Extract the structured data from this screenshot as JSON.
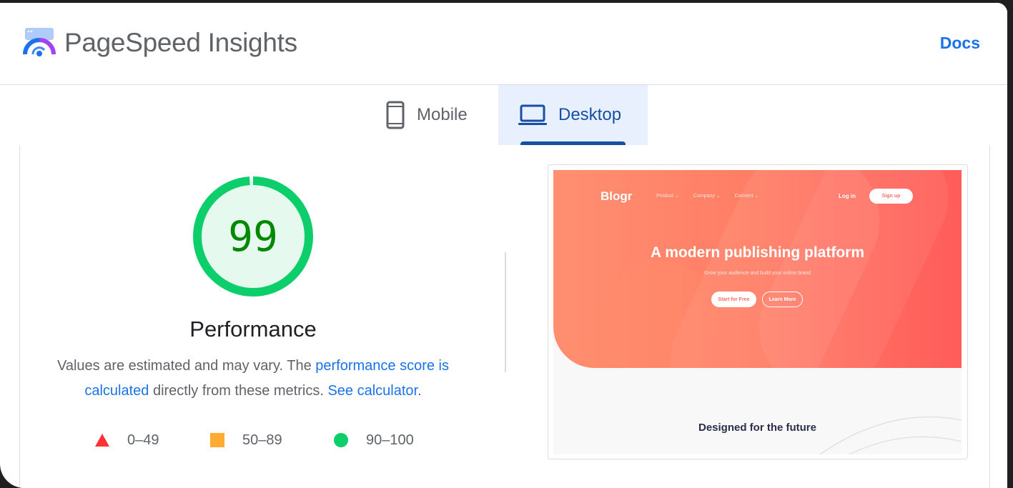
{
  "header": {
    "title": "PageSpeed Insights",
    "logo_icon": "pagespeed-logo-icon",
    "docs_label": "Docs"
  },
  "tabs": [
    {
      "label": "Mobile",
      "icon": "phone-icon",
      "selected": false
    },
    {
      "label": "Desktop",
      "icon": "laptop-icon",
      "selected": true
    }
  ],
  "performance": {
    "score": "99",
    "score_value": 99,
    "title": "Performance",
    "desc_part1": "Values are estimated and may vary. The ",
    "desc_link1": "performance score is calculated",
    "desc_part2": " directly from these metrics. ",
    "desc_link2": "See calculator",
    "desc_part3": ".",
    "legend": [
      {
        "shape": "triangle",
        "range": "0–49",
        "color": "#ff3333"
      },
      {
        "shape": "square",
        "range": "50–89",
        "color": "#ffaa33"
      },
      {
        "shape": "circle",
        "range": "90–100",
        "color": "#0cce6b"
      }
    ]
  },
  "colors": {
    "pass_ring": "#0cce6b",
    "pass_fill": "#e6f9ee",
    "pass_text": "#008800",
    "accent": "#1a73e8",
    "tab_active": "#174ea6"
  },
  "screenshot": {
    "logo": "Blogr",
    "nav": [
      "Product ⌄",
      "Company ⌄",
      "Connect ⌄"
    ],
    "login": "Log in",
    "signup": "Sign up",
    "headline": "A modern publishing platform",
    "subheadline": "Grow your audience and build your online brand",
    "cta_primary": "Start for Free",
    "cta_secondary": "Learn More",
    "section_title": "Designed for the future"
  }
}
